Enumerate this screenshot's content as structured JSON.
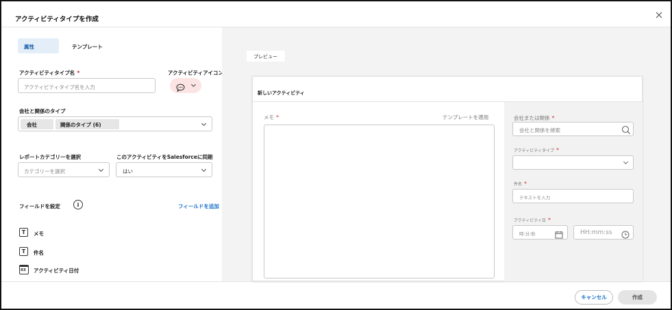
{
  "dialog": {
    "title": "アクティビティタイプを作成",
    "close_icon": "close-icon"
  },
  "tabs": [
    {
      "label": "属性",
      "active": true
    },
    {
      "label": "テンプレート",
      "active": false
    }
  ],
  "form": {
    "type_name": {
      "label": "アクティビティタイプ名",
      "required": "*",
      "placeholder": "アクティビティタイプ名を入力"
    },
    "icon": {
      "label": "アクティビティアイコン",
      "selected_icon": "chat-bubble-icon"
    },
    "company_relation": {
      "label": "会社と関係のタイプ",
      "chips": [
        "会社",
        "関係のタイプ (6)"
      ]
    },
    "report_category": {
      "label": "レポートカテゴリーを選択",
      "placeholder": "カテゴリーを選択"
    },
    "sync": {
      "label": "このアクティビティをSalesforceに同期",
      "value": "はい"
    },
    "fields": {
      "label": "フィールドを設定",
      "add_link": "フィールドを追加",
      "items": [
        {
          "icon": "text-field-icon",
          "glyph": "T",
          "label": "メモ"
        },
        {
          "icon": "text-field-icon",
          "glyph": "T",
          "label": "件名"
        },
        {
          "icon": "calendar-icon",
          "glyph": "03",
          "label": "アクティビティ日付"
        }
      ]
    }
  },
  "preview": {
    "title": "プレビュー",
    "card_title": "新しいアクティビティ",
    "memo": {
      "label": "メモ",
      "required": "*",
      "template_link": "テンプレートを適用"
    },
    "company": {
      "label": "会社または関係",
      "required": "*",
      "placeholder": "会社と関係を検索"
    },
    "activity_type": {
      "label": "アクティビティタイプ",
      "required": "*"
    },
    "subject": {
      "label": "件名",
      "required": "*",
      "placeholder": "テキストを入力"
    },
    "date": {
      "label": "アクティビティ日",
      "required": "*",
      "date_placeholder": "時:分:秒",
      "time_placeholder": "HH:mm:ss"
    }
  },
  "footer": {
    "cancel": "キャンセル",
    "create": "作成"
  },
  "colors": {
    "accent": "#1a73c8",
    "tab_active_bg": "#e3eef9",
    "icon_pill_bg": "#fde4e4",
    "right_panel_bg": "#f3f3f4"
  }
}
